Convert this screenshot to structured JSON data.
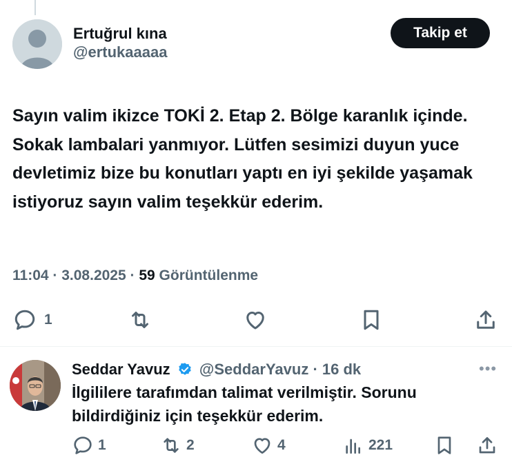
{
  "tweet": {
    "author_name": "Ertuğrul kına",
    "author_handle": "@ertukaaaaa",
    "follow_label": "Takip et",
    "text": "Sayın valim ikizce TOKİ 2. Etap 2. Bölge karanlık içinde. Sokak lambalari yanmıyor. Lütfen sesimizi duyun yuce devletimiz bize bu konutları yaptı en iyi şekilde yaşamak istiyoruz sayın valim teşekkür ederim.",
    "time": "11:04",
    "date": "3.08.2025",
    "views_count": "59",
    "views_label": "Görüntülenme",
    "reply_count": "1",
    "icons": [
      "reply-icon",
      "retweet-icon",
      "like-icon",
      "bookmark-icon",
      "share-icon"
    ]
  },
  "reply": {
    "author_name": "Seddar Yavuz",
    "author_handle": "@SeddarYavuz",
    "time": "16 dk",
    "text": "İlgililere tarafımdan talimat verilmiştir. Sorunu bildirdiğiniz için teşekkür ederim.",
    "reply_count": "1",
    "retweet_count": "2",
    "like_count": "4",
    "views_count": "221",
    "icons": [
      "reply-icon",
      "retweet-icon",
      "like-icon",
      "views-icon",
      "bookmark-icon",
      "share-icon"
    ]
  },
  "colors": {
    "text_primary": "#0f1419",
    "text_secondary": "#536471",
    "verified": "#1d9bf0",
    "follow_bg": "#0f1419"
  }
}
